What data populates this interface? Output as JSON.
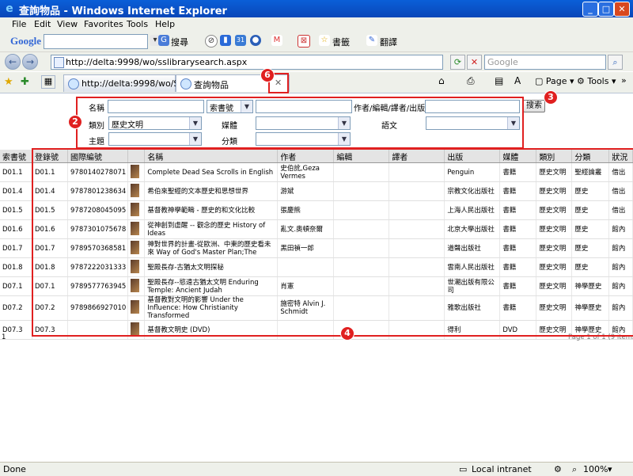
{
  "window": {
    "title": "查詢物品 - Windows Internet Explorer",
    "min": "_",
    "max": "□",
    "close": "✕"
  },
  "menu": [
    "File",
    "Edit",
    "View",
    "Favorites",
    "Tools",
    "Help"
  ],
  "googlebar": {
    "logo": "Google",
    "search_label": "搜尋",
    "bookmarks_label": "書籤",
    "translate_label": "翻譯"
  },
  "address": {
    "url": "http://delta:9998/wo/sslibrarysearch.aspx",
    "search_placeholder": "Google"
  },
  "tabs": [
    {
      "label": "http://delta:9998/wo/S..."
    },
    {
      "label": "查詢物品"
    }
  ],
  "toolbar": {
    "page": "Page",
    "tools": "Tools"
  },
  "form": {
    "name_label": "名稱",
    "callno_select": "索書號",
    "author_label": "作者/編輯/譯者/出版",
    "category_label": "類別",
    "category_value": "歷史文明",
    "media_label": "媒體",
    "language_label": "語文",
    "subject_label": "主題",
    "classification_label": "分類",
    "search_button": "搜索"
  },
  "annotations": [
    "2",
    "3",
    "4",
    "6"
  ],
  "table": {
    "headers": [
      "索書號",
      "登錄號",
      "國際編號",
      "",
      "名稱",
      "作者",
      "編輯",
      "譯者",
      "出版",
      "媒體",
      "類別",
      "分類",
      "狀況"
    ],
    "rows": [
      [
        "D01.1",
        "D01.1",
        "9780140278071",
        "Complete Dead Sea Scrolls in English",
        "史伯訛,Geza Vermes",
        "",
        "",
        "Penguin",
        "書籍",
        "歷史文明",
        "聖經論叢",
        "借出"
      ],
      [
        "D01.4",
        "D01.4",
        "9787801238634",
        "希伯來聖經的文本歷史和思想世界",
        "游斌",
        "",
        "",
        "宗教文化出版社",
        "書籍",
        "歷史文明",
        "歷史",
        "借出"
      ],
      [
        "D01.5",
        "D01.5",
        "9787208045095",
        "基督教神學範疇 - 歷史的和文化比較",
        "張慶熊",
        "",
        "",
        "上海人民出版社",
        "書籍",
        "歷史文明",
        "歷史",
        "借出"
      ],
      [
        "D01.6",
        "D01.6",
        "9787301075678",
        "從神創到虛醒 -- 觀念的歷史 History of Ideas",
        "亂文.奧頓奈爾",
        "",
        "",
        "北京大學出版社",
        "書籍",
        "歷史文明",
        "歷史",
        "館內"
      ],
      [
        "D01.7",
        "D01.7",
        "9789570368581",
        "神對世界的計畫-從歐洲、中東的歷史看未來 Way of God's Master Plan;The",
        "黑田禎一郎",
        "",
        "",
        "道聲出版社",
        "書籍",
        "歷史文明",
        "歷史",
        "館內"
      ],
      [
        "D01.8",
        "D01.8",
        "9787222031333",
        "聖殿長存-古猶太文明探秘",
        "",
        "",
        "",
        "雲南人民出版社",
        "書籍",
        "歷史文明",
        "歷史",
        "館內"
      ],
      [
        "D07.1",
        "D07.1",
        "9789577763945",
        "聖殿長存--慾遠古猶太文明 Enduring Temple: Ancient Judah",
        "肖憲",
        "",
        "",
        "世潮出版有限公司",
        "書籍",
        "歷史文明",
        "神學歷史",
        "館內"
      ],
      [
        "D07.2",
        "D07.2",
        "9789866927010",
        "基督教對文明的影響 Under the Influence: How Christianity Transformed",
        "施密特 Alvin J. Schmidt",
        "",
        "",
        "雅歌出版社",
        "書籍",
        "歷史文明",
        "神學歷史",
        "館內"
      ],
      [
        "D07.3",
        "D07.3",
        "",
        "基督教文明史 (DVD)",
        "",
        "",
        "",
        "得利",
        "DVD",
        "歷史文明",
        "神學歷史",
        "館內"
      ]
    ],
    "footer_left": "1",
    "pager": "Page 1 of 1 (9 items)"
  },
  "status": {
    "left": "Done",
    "zone": "Local intranet",
    "zoom": "100%"
  }
}
